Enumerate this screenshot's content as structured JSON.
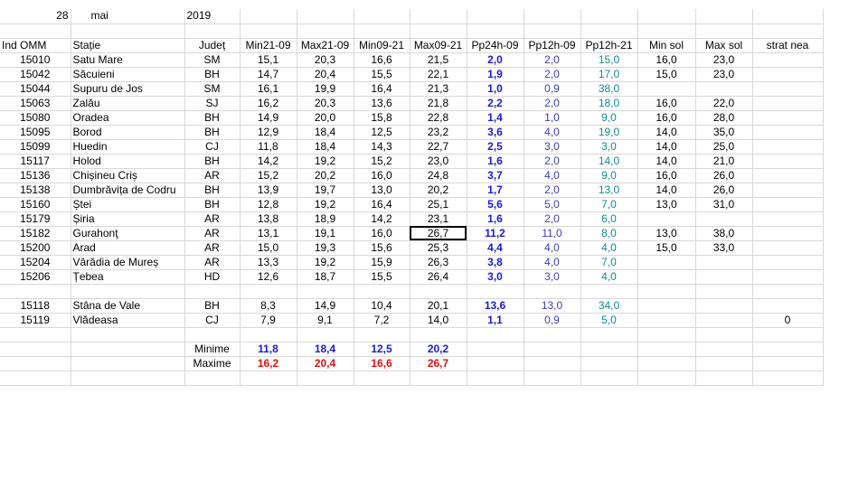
{
  "header": {
    "day": "28",
    "month": "mai",
    "year": "2019"
  },
  "columns": [
    "Ind OMM",
    "Stație",
    "Județ",
    "Min21-09",
    "Max21-09",
    "Min09-21",
    "Max09-21",
    "Pp24h-09",
    "Pp12h-09",
    "Pp12h-21",
    "Min sol",
    "Max sol",
    "strat nea"
  ],
  "rows": [
    {
      "id": "15010",
      "name": "Satu Mare",
      "county": "SM",
      "min2109": "15,1",
      "max2109": "20,3",
      "min0921": "16,6",
      "max0921": "21,5",
      "pp24": "2,0",
      "pp12a": "2,0",
      "pp12b": "15,0",
      "minsol": "16,0",
      "maxsol": "23,0",
      "snow": ""
    },
    {
      "id": "15042",
      "name": "Săcuieni",
      "county": "BH",
      "min2109": "14,7",
      "max2109": "20,4",
      "min0921": "15,5",
      "max0921": "22,1",
      "pp24": "1,9",
      "pp12a": "2,0",
      "pp12b": "17,0",
      "minsol": "15,0",
      "maxsol": "23,0",
      "snow": ""
    },
    {
      "id": "15044",
      "name": "Supuru de Jos",
      "county": "SM",
      "min2109": "16,1",
      "max2109": "19,9",
      "min0921": "16,4",
      "max0921": "21,3",
      "pp24": "1,0",
      "pp12a": "0,9",
      "pp12b": "38,0",
      "minsol": "",
      "maxsol": "",
      "snow": ""
    },
    {
      "id": "15063",
      "name": "Zalău",
      "county": "SJ",
      "min2109": "16,2",
      "max2109": "20,3",
      "min0921": "13,6",
      "max0921": "21,8",
      "pp24": "2,2",
      "pp12a": "2,0",
      "pp12b": "18,0",
      "minsol": "16,0",
      "maxsol": "22,0",
      "snow": ""
    },
    {
      "id": "15080",
      "name": "Oradea",
      "county": "BH",
      "min2109": "14,9",
      "max2109": "20,0",
      "min0921": "15,8",
      "max0921": "22,8",
      "pp24": "1,4",
      "pp12a": "1,0",
      "pp12b": "9,0",
      "minsol": "16,0",
      "maxsol": "28,0",
      "snow": ""
    },
    {
      "id": "15095",
      "name": "Borod",
      "county": "BH",
      "min2109": "12,9",
      "max2109": "18,4",
      "min0921": "12,5",
      "max0921": "23,2",
      "pp24": "3,6",
      "pp12a": "4,0",
      "pp12b": "19,0",
      "minsol": "14,0",
      "maxsol": "35,0",
      "snow": ""
    },
    {
      "id": "15099",
      "name": "Huedin",
      "county": "CJ",
      "min2109": "11,8",
      "max2109": "18,4",
      "min0921": "14,3",
      "max0921": "22,7",
      "pp24": "2,5",
      "pp12a": "3,0",
      "pp12b": "3,0",
      "minsol": "14,0",
      "maxsol": "25,0",
      "snow": ""
    },
    {
      "id": "15117",
      "name": "Holod",
      "county": "BH",
      "min2109": "14,2",
      "max2109": "19,2",
      "min0921": "15,2",
      "max0921": "23,0",
      "pp24": "1,6",
      "pp12a": "2,0",
      "pp12b": "14,0",
      "minsol": "14,0",
      "maxsol": "21,0",
      "snow": ""
    },
    {
      "id": "15136",
      "name": "Chișineu    Criș",
      "county": "AR",
      "min2109": "15,2",
      "max2109": "20,2",
      "min0921": "16,0",
      "max0921": "24,8",
      "pp24": "3,7",
      "pp12a": "4,0",
      "pp12b": "9,0",
      "minsol": "16,0",
      "maxsol": "26,0",
      "snow": ""
    },
    {
      "id": "15138",
      "name": "Dumbrăvița de Codru",
      "county": "BH",
      "min2109": "13,9",
      "max2109": "19,7",
      "min0921": "13,0",
      "max0921": "20,2",
      "pp24": "1,7",
      "pp12a": "2,0",
      "pp12b": "13,0",
      "minsol": "14,0",
      "maxsol": "26,0",
      "snow": ""
    },
    {
      "id": "15160",
      "name": "Ștei",
      "county": "BH",
      "min2109": "12,8",
      "max2109": "19,2",
      "min0921": "16,4",
      "max0921": "25,1",
      "pp24": "5,6",
      "pp12a": "5,0",
      "pp12b": "7,0",
      "minsol": "13,0",
      "maxsol": "31,0",
      "snow": ""
    },
    {
      "id": "15179",
      "name": "Șiria",
      "county": "AR",
      "min2109": "13,8",
      "max2109": "18,9",
      "min0921": "14,2",
      "max0921": "23,1",
      "pp24": "1,6",
      "pp12a": "2,0",
      "pp12b": "6,0",
      "minsol": "",
      "maxsol": "",
      "snow": ""
    },
    {
      "id": "15182",
      "name": "Gurahonţ",
      "county": "AR",
      "min2109": "13,1",
      "max2109": "19,1",
      "min0921": "16,0",
      "max0921": "26,7",
      "pp24": "11,2",
      "pp12a": "11,0",
      "pp12b": "8,0",
      "minsol": "13,0",
      "maxsol": "38,0",
      "snow": "",
      "selected": "max0921"
    },
    {
      "id": "15200",
      "name": "Arad",
      "county": "AR",
      "min2109": "15,0",
      "max2109": "19,3",
      "min0921": "15,6",
      "max0921": "25,3",
      "pp24": "4,4",
      "pp12a": "4,0",
      "pp12b": "4,0",
      "minsol": "15,0",
      "maxsol": "33,0",
      "snow": ""
    },
    {
      "id": "15204",
      "name": "Vârădia de Mureș",
      "county": "AR",
      "min2109": "13,3",
      "max2109": "19,2",
      "min0921": "15,9",
      "max0921": "26,3",
      "pp24": "3,8",
      "pp12a": "4,0",
      "pp12b": "7,0",
      "minsol": "",
      "maxsol": "",
      "snow": ""
    },
    {
      "id": "15206",
      "name": "Țebea",
      "county": "HD",
      "min2109": "12,6",
      "max2109": "18,7",
      "min0921": "15,5",
      "max0921": "26,4",
      "pp24": "3,0",
      "pp12a": "3,0",
      "pp12b": "4,0",
      "minsol": "",
      "maxsol": "",
      "snow": ""
    },
    {
      "blank": true
    },
    {
      "id": "15118",
      "name": "Stâna de Vale",
      "county": "BH",
      "min2109": "8,3",
      "max2109": "14,9",
      "min0921": "10,4",
      "max0921": "20,1",
      "pp24": "13,6",
      "pp12a": "13,0",
      "pp12b": "34,0",
      "minsol": "",
      "maxsol": "",
      "snow": ""
    },
    {
      "id": "15119",
      "name": "Vlădeasa",
      "county": "CJ",
      "min2109": "7,9",
      "max2109": "9,1",
      "min0921": "7,2",
      "max0921": "14,0",
      "pp24": "1,1",
      "pp12a": "0,9",
      "pp12b": "5,0",
      "minsol": "",
      "maxsol": "",
      "snow": "0"
    }
  ],
  "summary": {
    "min_label": "Minime",
    "max_label": "Maxime",
    "min": [
      "11,8",
      "18,4",
      "12,5",
      "20,2"
    ],
    "max": [
      "16,2",
      "20,4",
      "16,6",
      "26,7"
    ]
  },
  "colors": {
    "grid": "#d8d8d8",
    "blue_bold": "#1a1ad6",
    "purple": "#3c3cbf",
    "teal": "#0f8c8c",
    "red": "#e01010"
  }
}
